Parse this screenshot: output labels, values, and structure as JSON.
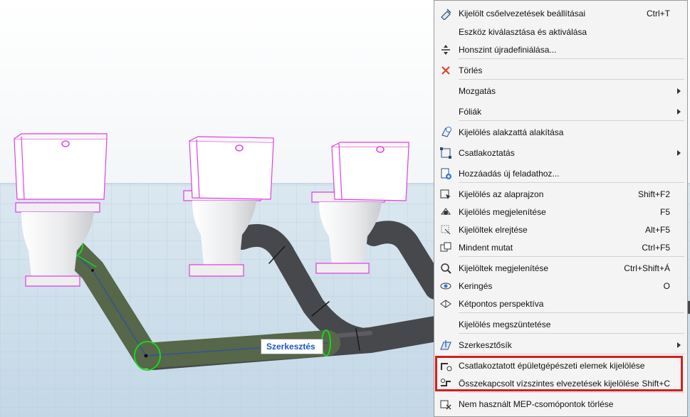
{
  "viewport": {
    "tooltip": "Szerkesztés"
  },
  "menu": {
    "items": [
      {
        "label": "Kijelölt csőelvezetések beállításai",
        "shortcut": "Ctrl+T",
        "icon": "pipe-settings-icon"
      },
      {
        "label": "Eszköz kiválasztása és aktiválása",
        "shortcut": "",
        "icon": ""
      },
      {
        "label": "Honszint újradefiniálása...",
        "shortcut": "",
        "icon": "level-redefine-icon"
      },
      {
        "label": "Törlés",
        "shortcut": "",
        "icon": "delete-x-icon"
      },
      {
        "label": "Mozgatás",
        "shortcut": "",
        "icon": "",
        "submenu": true
      },
      {
        "label": "Fóliák",
        "shortcut": "",
        "icon": "",
        "submenu": true
      },
      {
        "label": "Kijelölés alakzattá alakítása",
        "shortcut": "",
        "icon": "convert-to-morph-icon"
      },
      {
        "label": "Csatlakoztatás",
        "shortcut": "",
        "icon": "connect-icon",
        "submenu": true
      },
      {
        "label": "Hozzáadás új feladathoz...",
        "shortcut": "",
        "icon": "add-to-task-icon"
      },
      {
        "label": "Kijelölés az alaprajzon",
        "shortcut": "Shift+F2",
        "icon": "select-on-floorplan-icon"
      },
      {
        "label": "Kijelölés megjelenítése",
        "shortcut": "F5",
        "icon": "show-selection-icon"
      },
      {
        "label": "Kijelöltek elrejtése",
        "shortcut": "Alt+F5",
        "icon": "hide-selected-icon"
      },
      {
        "label": "Mindent mutat",
        "shortcut": "Ctrl+F5",
        "icon": "show-all-icon"
      },
      {
        "label": "Kijelöltek megjelenítése",
        "shortcut": "Ctrl+Shift+Á",
        "icon": "zoom-to-selection-icon"
      },
      {
        "label": "Keringés",
        "shortcut": "O",
        "icon": "orbit-icon"
      },
      {
        "label": "Kétpontos perspektíva",
        "shortcut": "",
        "icon": "two-point-perspective-icon"
      },
      {
        "label": "Kijelölés megszüntetése",
        "shortcut": "",
        "icon": ""
      },
      {
        "label": "Szerkesztősík",
        "shortcut": "",
        "icon": "editing-plane-icon",
        "submenu": true
      },
      {
        "label": "Csatlakoztatott épületgépészeti elemek kijelölése",
        "shortcut": "",
        "icon": "select-connected-mep-icon"
      },
      {
        "label": "Összekapcsolt vízszintes elvezetések kijelölése",
        "shortcut": "Shift+C",
        "icon": "select-linked-routes-icon"
      },
      {
        "label": "Nem használt MEP-csomópontok törlése",
        "shortcut": "",
        "icon": "delete-unused-nodes-icon"
      }
    ]
  },
  "colors": {
    "highlight_border": "#d21f1f",
    "pipe_dark": "#4a4b4f",
    "pipe_selected": "#5a6a4a",
    "selection_green": "#19d619",
    "magenta_outline": "#e040e0",
    "tooltip_text": "#1c56c7"
  }
}
